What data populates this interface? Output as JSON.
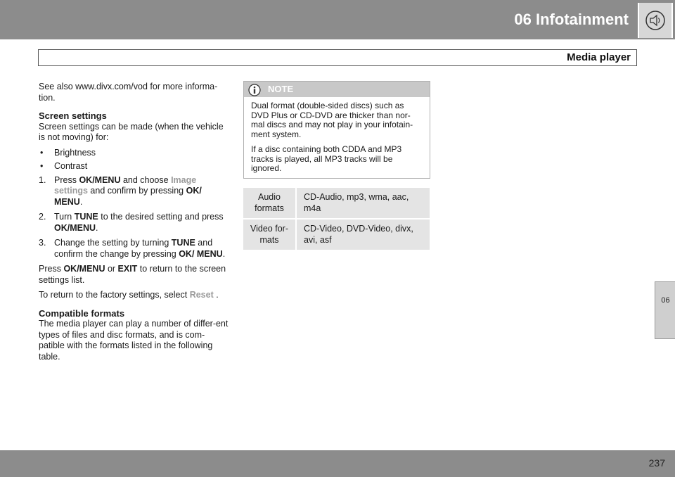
{
  "header": {
    "chapter": "06 Infotainment",
    "section": "Media player",
    "side_tab": "06"
  },
  "footer": {
    "page_number": "237"
  },
  "column1": {
    "intro": "See also www.divx.com/vod for more informa-tion.",
    "screen_settings": {
      "heading": "Screen settings",
      "desc": "Screen settings can be made (when the vehicle is not moving) for:",
      "bullets": [
        "Brightness",
        "Contrast"
      ],
      "steps": [
        {
          "num": "1.",
          "t1": "Press ",
          "b1": "OK/MENU",
          "t2": " and choose ",
          "hl": "Image settings",
          "t3": " and confirm by pressing ",
          "b2": "OK/ MENU",
          "t4": "."
        },
        {
          "num": "2.",
          "t1": "Turn ",
          "b1": "TUNE",
          "t2": " to the desired setting and press ",
          "b2": "OK/MENU",
          "t3": "."
        },
        {
          "num": "3.",
          "t1": "Change the setting by turning ",
          "b1": "TUNE",
          "t2": " and confirm the change by pressing ",
          "b2": "OK/ MENU",
          "t3": "."
        }
      ],
      "return_text": {
        "t1": "Press ",
        "b1": "OK/MENU",
        "t2": " or ",
        "b2": "EXIT",
        "t3": " to return to the screen settings list."
      },
      "factory_text": {
        "t1": "To return to the factory settings, select ",
        "hl": "Reset",
        "t2": " ."
      }
    },
    "compatible_formats": {
      "heading": "Compatible formats",
      "desc": "The media player can play a number of differ-ent types of files and disc formats, and is com-patible with the formats listed in the following table."
    }
  },
  "note": {
    "label": "NOTE",
    "paragraphs": [
      "Dual format (double-sided discs) such as DVD Plus or CD-DVD are thicker than nor-mal discs and may not play in your infotain-ment system.",
      "If a disc containing both CDDA and MP3 tracks is played, all MP3 tracks will be ignored."
    ]
  },
  "formats_table": [
    {
      "type": "Audio formats",
      "formats": "CD-Audio, mp3, wma, aac, m4a"
    },
    {
      "type": "Video for-mats",
      "formats": "CD-Video, DVD-Video, divx, avi, asf"
    }
  ],
  "colors": {
    "bar_gray": "#8c8c8c",
    "table_gray": "#e4e4e4",
    "highlight_gray": "#9a9a9a"
  }
}
